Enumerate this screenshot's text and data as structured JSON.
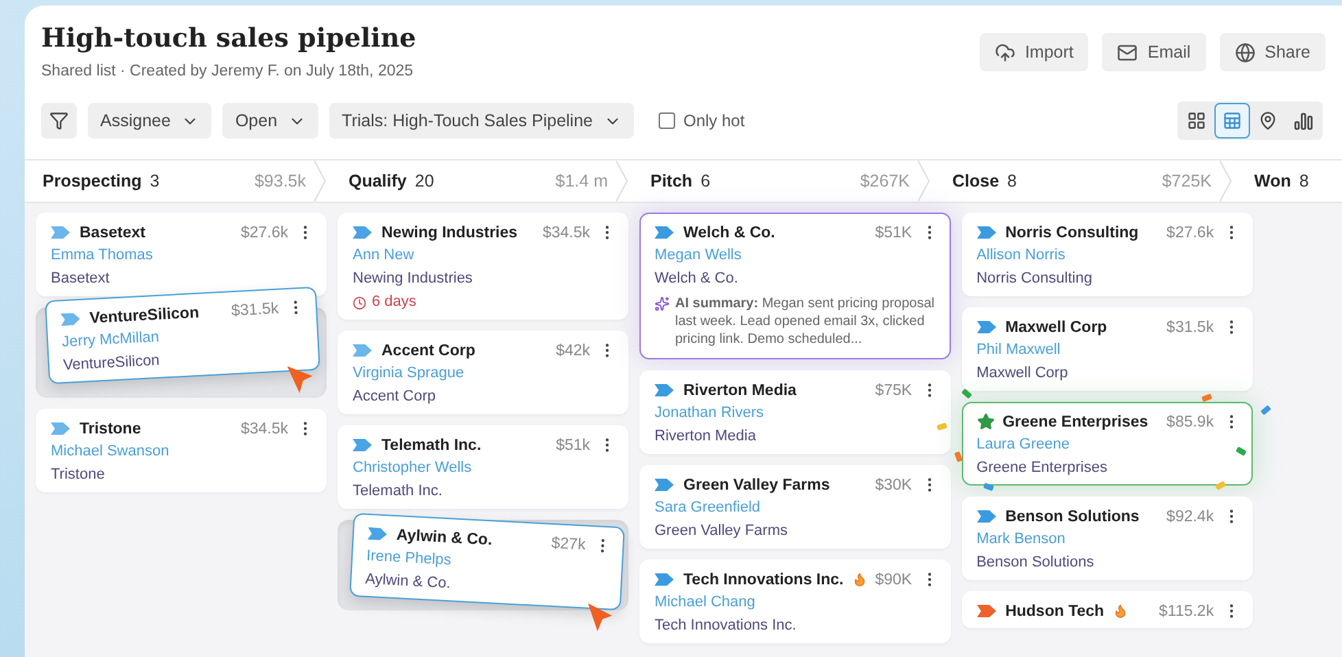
{
  "header": {
    "title": "High-touch sales pipeline",
    "subtitle": "Shared list · Created by Jeremy F. on July 18th, 2025",
    "actions": [
      {
        "kind": "import",
        "label": "Import"
      },
      {
        "kind": "email",
        "label": "Email"
      },
      {
        "kind": "share",
        "label": "Share"
      }
    ]
  },
  "toolbar": {
    "filters": [
      "Assignee",
      "Open",
      "Trials: High-Touch Sales Pipeline"
    ],
    "only_hot": {
      "label": "Only hot",
      "checked": false
    },
    "views": [
      {
        "kind": "grid",
        "selected": false
      },
      {
        "kind": "table",
        "selected": true
      },
      {
        "kind": "pin",
        "selected": false
      },
      {
        "kind": "chart",
        "selected": false
      }
    ]
  },
  "stages": [
    {
      "name": "Prospecting",
      "count": "3",
      "total": "$93.5k",
      "items": [
        {
          "kind": "deal",
          "company": "Basetext",
          "amount": "$27.6k",
          "contact": "Emma Thomas",
          "account": "Basetext",
          "starred": false,
          "color": "#6bb6ea",
          "hot": false,
          "focused": false,
          "celebrating": false
        },
        {
          "kind": "drop-slot",
          "deal": {
            "company": "VentureSilicon",
            "amount": "$31.5k",
            "contact": "Jerry McMillan",
            "account": "VentureSilicon",
            "starred": false,
            "color": "#6bb6ea",
            "hot": false,
            "focused": false,
            "celebrating": false
          }
        },
        {
          "kind": "deal",
          "company": "Tristone",
          "amount": "$34.5k",
          "contact": "Michael Swanson",
          "account": "Tristone",
          "starred": false,
          "color": "#6bb6ea",
          "hot": false,
          "focused": false,
          "celebrating": false
        }
      ]
    },
    {
      "name": "Qualify",
      "count": "20",
      "total": "$1.4 m",
      "items": [
        {
          "kind": "deal",
          "company": "Newing Industries",
          "amount": "$34.5k",
          "contact": "Ann New",
          "account": "Newing Industries",
          "due": "6 days",
          "starred": false,
          "color": "#4aa3e4",
          "hot": false,
          "focused": false,
          "celebrating": false
        },
        {
          "kind": "deal",
          "company": "Accent Corp",
          "amount": "$42k",
          "contact": "Virginia Sprague",
          "account": "Accent Corp",
          "starred": false,
          "color": "#6bb6ea",
          "hot": false,
          "focused": false,
          "celebrating": false
        },
        {
          "kind": "deal",
          "company": "Telemath Inc.",
          "amount": "$51k",
          "contact": "Christopher Wells",
          "account": "Telemath Inc.",
          "starred": false,
          "color": "#4aa3e4",
          "hot": false,
          "focused": false,
          "celebrating": false
        },
        {
          "kind": "drop-slot",
          "deal": {
            "company": "Aylwin & Co.",
            "amount": "$27k",
            "contact": "Irene Phelps",
            "account": "Aylwin & Co.",
            "starred": false,
            "color": "#4aa3e4",
            "hot": false,
            "focused": false,
            "celebrating": false
          }
        }
      ]
    },
    {
      "name": "Pitch",
      "count": "6",
      "total": "$267K",
      "items": [
        {
          "kind": "deal",
          "company": "Welch & Co.",
          "amount": "$51K",
          "contact": "Megan Wells",
          "account": "Welch & Co.",
          "summary": "**AI summary:** Megan sent pricing proposal last week. Lead opened email 3x, clicked pricing link. Demo scheduled...",
          "starred": false,
          "color": "#3b9be0",
          "hot": false,
          "focused": true,
          "celebrating": false
        },
        {
          "kind": "deal",
          "company": "Riverton Media",
          "amount": "$75K",
          "contact": "Jonathan Rivers",
          "account": "Riverton Media",
          "starred": false,
          "color": "#3b9be0",
          "hot": false,
          "focused": false,
          "celebrating": false
        },
        {
          "kind": "deal",
          "company": "Green Valley Farms",
          "amount": "$30K",
          "contact": "Sara Greenfield",
          "account": "Green Valley Farms",
          "starred": false,
          "color": "#3b9be0",
          "hot": false,
          "focused": false,
          "celebrating": false
        },
        {
          "kind": "deal",
          "company": "Tech Innovations Inc.",
          "amount": "$90K",
          "contact": "Michael Chang",
          "account": "Tech Innovations Inc.",
          "starred": false,
          "color": "#3b9be0",
          "hot": true,
          "focused": false,
          "celebrating": false
        }
      ]
    },
    {
      "name": "Close",
      "count": "8",
      "total": "$725K",
      "items": [
        {
          "kind": "deal",
          "company": "Norris Consulting",
          "amount": "$27.6k",
          "contact": "Allison Norris",
          "account": "Norris Consulting",
          "starred": false,
          "color": "#3b9be0",
          "hot": false,
          "focused": false,
          "celebrating": false
        },
        {
          "kind": "deal",
          "company": "Maxwell Corp",
          "amount": "$31.5k",
          "contact": "Phil Maxwell",
          "account": "Maxwell Corp",
          "starred": false,
          "color": "#3b9be0",
          "hot": false,
          "focused": false,
          "celebrating": false
        },
        {
          "kind": "deal",
          "company": "Greene Enterprises",
          "amount": "$85.9k",
          "contact": "Laura Greene",
          "account": "Greene Enterprises",
          "starred": true,
          "color": "#2e9a48",
          "hot": false,
          "focused": false,
          "celebrating": true
        },
        {
          "kind": "deal",
          "company": "Benson Solutions",
          "amount": "$92.4k",
          "contact": "Mark Benson",
          "account": "Benson Solutions",
          "starred": false,
          "color": "#3b9be0",
          "hot": false,
          "focused": false,
          "celebrating": false
        },
        {
          "kind": "deal",
          "company": "Hudson Tech",
          "amount": "$115.2k",
          "starred": false,
          "color": "#f0602a",
          "hot": true,
          "focused": false,
          "celebrating": false
        }
      ]
    },
    {
      "name": "Won",
      "count": "8"
    }
  ]
}
